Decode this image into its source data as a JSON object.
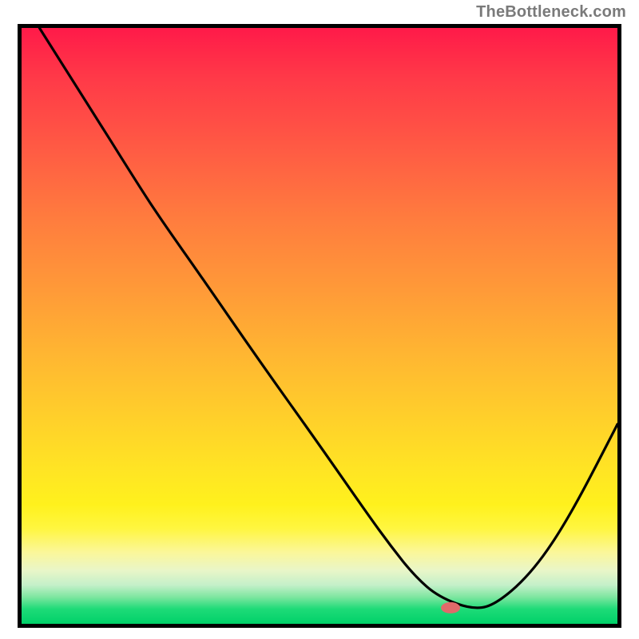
{
  "attribution": "TheBottleneck.com",
  "chart_data": {
    "type": "line",
    "title": "",
    "xlabel": "",
    "ylabel": "",
    "xlim": [
      0,
      100
    ],
    "ylim": [
      0,
      100
    ],
    "grid": false,
    "legend": false,
    "series": [
      {
        "name": "curve",
        "x": [
          3,
          10,
          20,
          24,
          30,
          40,
          50,
          58,
          62,
          66,
          70,
          76,
          80,
          86,
          92,
          100
        ],
        "y": [
          100,
          89,
          73,
          67,
          58.5,
          44,
          30,
          18.5,
          13,
          8,
          4.5,
          2.3,
          3.5,
          9,
          18,
          33.5
        ]
      }
    ],
    "marker": {
      "name": "highlight",
      "x": 72,
      "y": 2.7,
      "color": "#e06a6a",
      "rx": 12,
      "ry": 7
    }
  },
  "colors": {
    "frame": "#000000",
    "marker": "#e06a6a"
  }
}
